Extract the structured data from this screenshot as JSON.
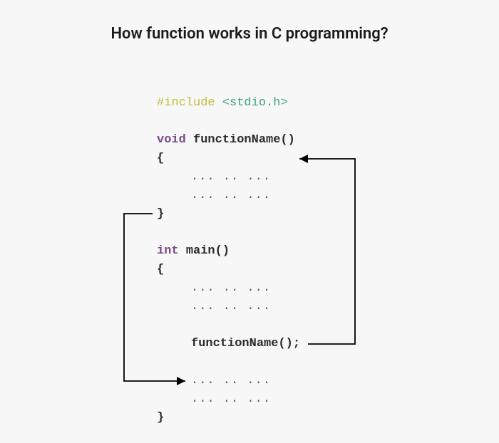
{
  "title": "How function works in C programming?",
  "code": {
    "include": "#include",
    "header": "<stdio.h>",
    "void_kw": "void",
    "func_name_decl": "functionName()",
    "open_brace": "{",
    "close_brace": "}",
    "ellipsis": "... .. ...",
    "int_kw": "int",
    "main_name": "main()",
    "func_call": "functionName();"
  }
}
